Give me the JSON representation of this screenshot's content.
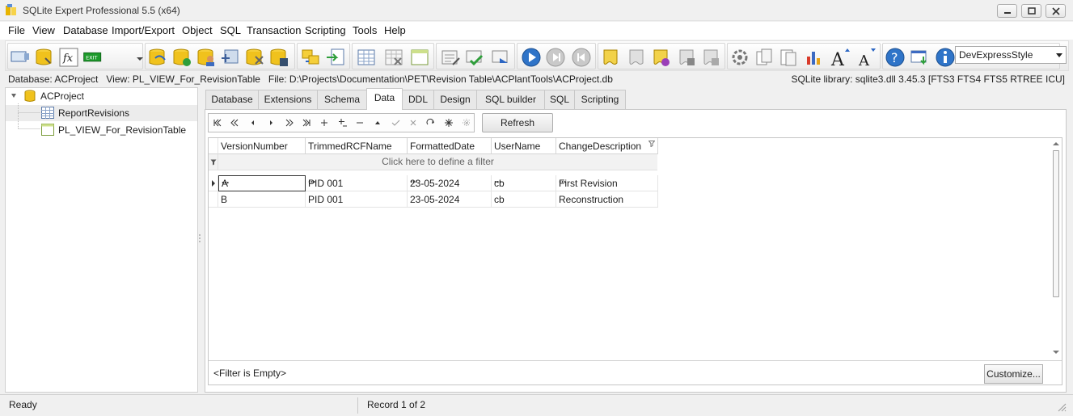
{
  "window": {
    "title": "SQLite Expert Professional 5.5 (x64)",
    "buttons": [
      {
        "name": "minimize",
        "icon": "minimize-icon"
      },
      {
        "name": "maximize",
        "icon": "maximize-icon"
      },
      {
        "name": "close",
        "icon": "close-icon"
      }
    ]
  },
  "menu": [
    "File",
    "View",
    "Database",
    "Import/Export",
    "Object",
    "SQL",
    "Transaction",
    "Scripting",
    "Tools",
    "Help"
  ],
  "toolbar": {
    "style_select": "DevExpressStyle"
  },
  "info": {
    "left": "Database: ACProject   View: PL_VIEW_For_RevisionTable   File: D:\\Projects\\Documentation\\PET\\Revision Table\\ACPlantTools\\ACProject.db",
    "right": "SQLite library: sqlite3.dll 3.45.3 [FTS3 FTS4 FTS5 RTREE ICU]"
  },
  "tree": {
    "root": "ACProject",
    "children": [
      "ReportRevisions",
      "PL_VIEW_For_RevisionTable"
    ]
  },
  "tabs": [
    "Database",
    "Extensions",
    "Schema",
    "Data",
    "DDL",
    "Design",
    "SQL builder",
    "SQL",
    "Scripting"
  ],
  "active_tab": "Data",
  "refresh_label": "Refresh",
  "grid": {
    "columns": [
      "VersionNumber",
      "TrimmedRCFName",
      "FormattedDate",
      "UserName",
      "ChangeDescription"
    ],
    "filter_prompt": "Click here to define a filter",
    "rows": [
      [
        "A",
        "PID 001",
        "23-05-2024",
        "cb",
        "First Revision"
      ],
      [
        "B",
        "PID 001",
        "23-05-2024",
        "cb",
        "Reconstruction"
      ]
    ],
    "filter_status": "<Filter is Empty>",
    "customize_label": "Customize..."
  },
  "status": {
    "left": "Ready",
    "record": "Record 1 of 2"
  }
}
